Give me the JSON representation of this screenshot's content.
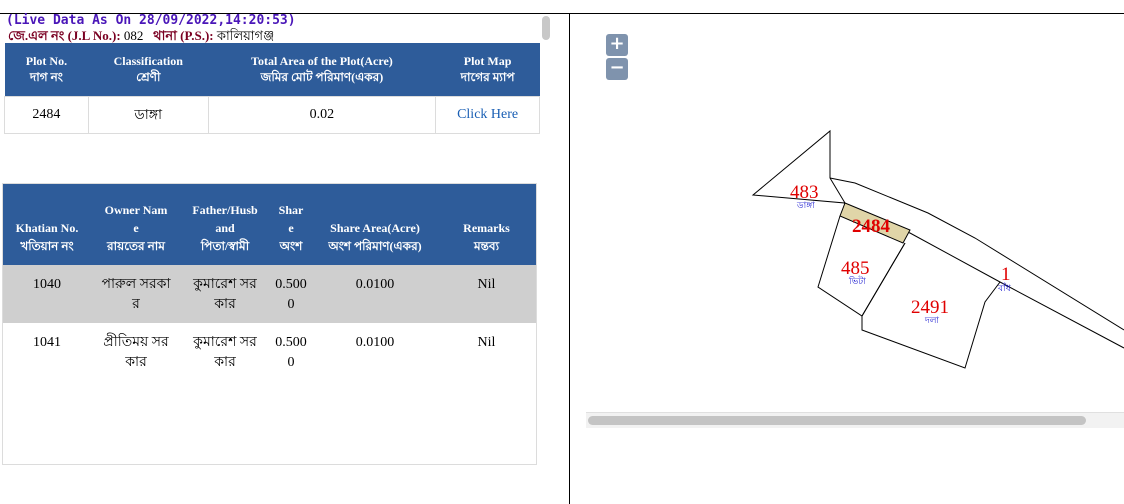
{
  "header": {
    "live_data": "(Live Data As On 28/09/2022,14:20:53)",
    "jl_label": "জে.এল নং (J.L No.):",
    "jl_value": "082",
    "ps_label": "থানা (P.S.):",
    "ps_value": "কালিয়াগঞ্জ"
  },
  "plot_table": {
    "headers": [
      [
        "Plot No.",
        "দাগ নং"
      ],
      [
        "Classification",
        "শ্রেণী"
      ],
      [
        "Total Area of the Plot(Acre)",
        "জমির মোট পরিমাণ(একর)"
      ],
      [
        "Plot Map",
        "দাগের ম্যাপ"
      ]
    ],
    "row": {
      "plot_no": "2484",
      "classification": "ডাঙ্গা",
      "area": "0.02",
      "map_link": "Click Here"
    }
  },
  "owner_table": {
    "headers": [
      [
        "Khatian No.",
        "খতিয়ান নং"
      ],
      [
        "Owner Nam",
        "e",
        "রায়তের নাম"
      ],
      [
        "Father/Husb",
        "and",
        "পিতা/স্বামী"
      ],
      [
        "Shar",
        "e",
        "অংশ"
      ],
      [
        "Share Area(Acre)",
        "অংশ পরিমাণ(একর)"
      ],
      [
        "Remarks",
        "মন্তব্য"
      ]
    ],
    "rows": [
      {
        "khatian": "1040",
        "owner": [
          "পারুল সরকা",
          "র"
        ],
        "father": [
          "কুমারেশ সর",
          "কার"
        ],
        "share": [
          "0.500",
          "0"
        ],
        "share_area": "0.0100",
        "remarks": "Nil"
      },
      {
        "khatian": "1041",
        "owner": [
          "প্রীতিময় সর",
          "কার"
        ],
        "father": [
          "কুমারেশ সর",
          "কার"
        ],
        "share": [
          "0.500",
          "0"
        ],
        "share_area": "0.0100",
        "remarks": "Nil"
      }
    ]
  },
  "map": {
    "zoom_in": "+",
    "zoom_out": "−",
    "highlight_color": "#e0d5a8",
    "plots": [
      {
        "number": "483",
        "class": "ডাঙ্গা"
      },
      {
        "number": "2484",
        "class": ""
      },
      {
        "number": "485",
        "class": "ভিটা"
      },
      {
        "number": "2491",
        "class": "দলা"
      },
      {
        "number": "1",
        "class": "বাঁধ"
      }
    ]
  }
}
